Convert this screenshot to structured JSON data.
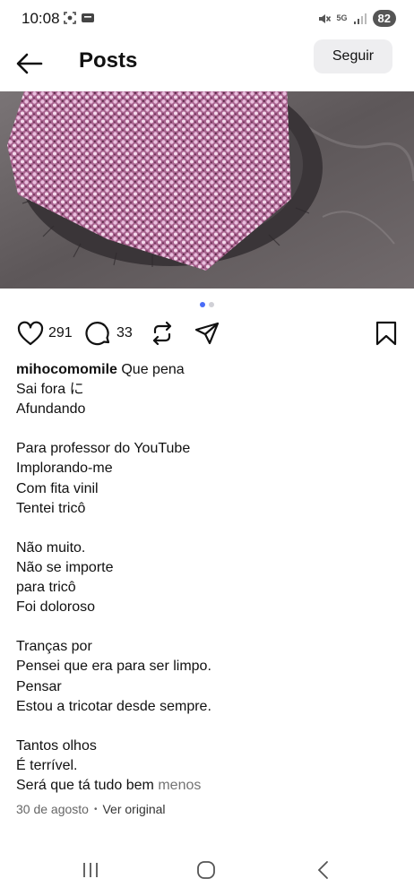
{
  "status_bar": {
    "time": "10:08",
    "network_label": "5G",
    "battery": "82",
    "icons": [
      "screenshot-icon",
      "notification-icon",
      "mute-icon",
      "signal-icon",
      "battery-icon"
    ]
  },
  "header": {
    "title": "Posts",
    "follow_label": "Seguir",
    "back_icon": "arrow-left-icon"
  },
  "carousel": {
    "slides": 2,
    "active_index": 0,
    "active_color": "#4a6cf7"
  },
  "actions": {
    "likes": "291",
    "comments": "33",
    "icons": [
      "heart-icon",
      "comment-icon",
      "repost-icon",
      "send-icon",
      "bookmark-icon"
    ]
  },
  "caption": {
    "username": "mihocomomile",
    "first_line_text": "Que pena",
    "lines": [
      "Sai fora に",
      "Afundando",
      "",
      "Para professor do YouTube",
      "Implorando-me",
      "Com fita vinil",
      "Tentei tricô",
      "",
      "Não muito.",
      "Não se importe",
      "para tricô",
      "Foi doloroso",
      "",
      "Tranças por",
      "Pensei que era para ser limpo.",
      "Pensar",
      "Estou a tricotar desde sempre.",
      "",
      "Tantos olhos",
      "É terrível."
    ],
    "last_line_text": "Será que tá tudo bem",
    "less_label": "menos"
  },
  "meta": {
    "date": "30 de agosto",
    "separator": "•",
    "translate_label": "Ver original"
  },
  "nav_bar": {
    "icons": [
      "recent-apps-icon",
      "home-icon",
      "back-icon"
    ]
  }
}
